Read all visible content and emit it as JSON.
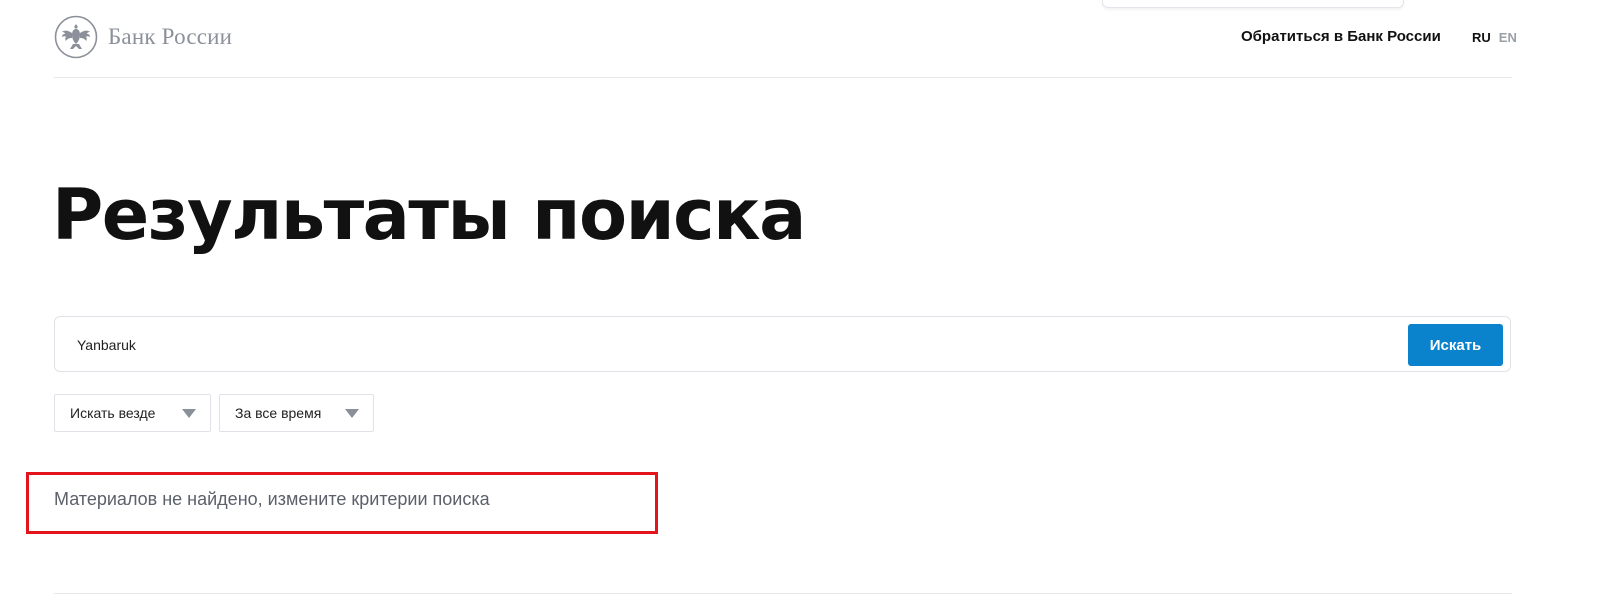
{
  "header": {
    "logo_text": "Банк России",
    "contact_link": "Обратиться в Банк России",
    "languages": {
      "ru": "RU",
      "en": "EN"
    }
  },
  "main": {
    "title": "Результаты поиска",
    "search": {
      "value": "Yanbaruk",
      "button_label": "Искать"
    },
    "filters": {
      "where": "Искать везде",
      "time": "За все время"
    },
    "no_results_message": "Материалов не найдено, измените критерии поиска"
  },
  "colors": {
    "accent": "#0a83cc",
    "highlight": "#e3141c",
    "muted_text": "#5b606a"
  },
  "icons": {
    "logo": "double-headed-eagle-icon",
    "dropdown": "chevron-down-icon"
  }
}
